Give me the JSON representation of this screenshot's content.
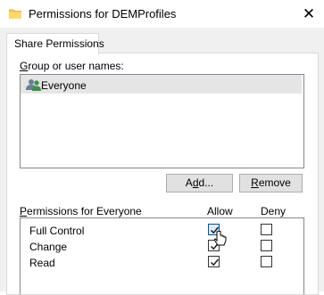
{
  "window": {
    "title": "Permissions for DEMProfiles",
    "close_glyph": "✕"
  },
  "tabs": [
    {
      "label": "Share Permissions"
    }
  ],
  "group_section": {
    "label_u": "G",
    "label_rest": "roup or user names:",
    "users": [
      {
        "name": "Everyone",
        "icon": "users-icon",
        "selected": true
      }
    ]
  },
  "buttons": {
    "add": {
      "u": "d",
      "pre": "A",
      "post": "d..."
    },
    "remove": {
      "u": "R",
      "post": "emove"
    }
  },
  "permissions_section": {
    "label_u": "P",
    "label_rest": "ermissions for Everyone",
    "allow_header": "Allow",
    "deny_header": "Deny",
    "rows": [
      {
        "name": "Full Control",
        "allow": true,
        "deny": false
      },
      {
        "name": "Change",
        "allow": true,
        "deny": false
      },
      {
        "name": "Read",
        "allow": true,
        "deny": false
      }
    ]
  },
  "colors": {
    "selection": "#e5e5e5",
    "dialog_bg": "#f0f0f0",
    "folder": "#f6c956"
  }
}
